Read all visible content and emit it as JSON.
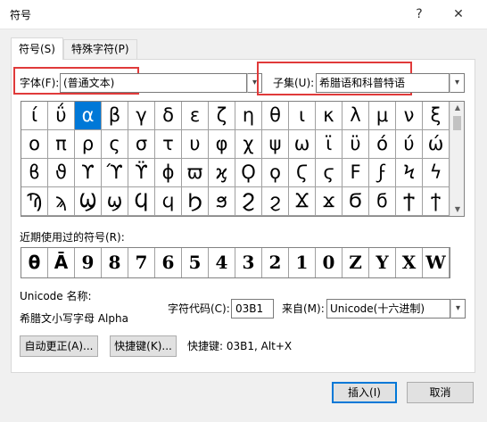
{
  "window": {
    "title": "符号",
    "help": "?",
    "close": "✕"
  },
  "tabs": {
    "symbols": "符号(S)",
    "special": "特殊字符(P)"
  },
  "font": {
    "label": "字体(F):",
    "value": "(普通文本)"
  },
  "subset": {
    "label": "子集(U):",
    "value": "希腊语和科普特语"
  },
  "selected_index": 2,
  "symbols": [
    "ί",
    "ΰ",
    "α",
    "β",
    "γ",
    "δ",
    "ε",
    "ζ",
    "η",
    "θ",
    "ι",
    "κ",
    "λ",
    "μ",
    "ν",
    "ξ",
    "ο",
    "π",
    "ρ",
    "ς",
    "σ",
    "τ",
    "υ",
    "φ",
    "χ",
    "ψ",
    "ω",
    "ϊ",
    "ϋ",
    "ό",
    "ύ",
    "ώ",
    "ϐ",
    "ϑ",
    "ϒ",
    "ϓ",
    "ϔ",
    "ϕ",
    "ϖ",
    "ϗ",
    "Ϙ",
    "ϙ",
    "Ϛ",
    "ϛ",
    "Ϝ",
    "ϝ",
    "Ϟ",
    "ϟ",
    "Ϡ",
    "ϡ",
    "Ϣ",
    "ϣ",
    "Ϥ",
    "ϥ",
    "Ϧ",
    "ϧ",
    "Ϩ",
    "ϩ",
    "Ϫ",
    "ϫ",
    "Ϭ",
    "ϭ",
    "Ϯ",
    "ϯ"
  ],
  "recent": {
    "label": "近期使用过的符号(R):",
    "items": [
      "θ",
      "Ā",
      "9",
      "8",
      "7",
      "6",
      "5",
      "4",
      "3",
      "2",
      "1",
      "0",
      "Z",
      "Y",
      "X",
      "W"
    ]
  },
  "unicode": {
    "name_label": "Unicode 名称:",
    "name_value": "希腊文小写字母 Alpha",
    "code_label": "字符代码(C):",
    "code_value": "03B1",
    "from_label": "来自(M):",
    "from_value": "Unicode(十六进制)"
  },
  "buttons": {
    "autocorrect": "自动更正(A)...",
    "shortcut_key": "快捷键(K)...",
    "shortcut_text": "快捷键: 03B1, Alt+X",
    "insert": "插入(I)",
    "cancel": "取消"
  },
  "colors": {
    "selection": "#0078d7",
    "highlight": "#e03a3a"
  }
}
